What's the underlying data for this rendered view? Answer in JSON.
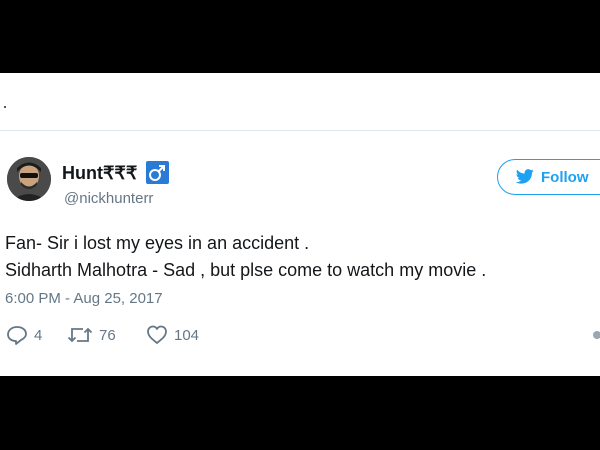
{
  "tweet": {
    "user": {
      "display_name": "Hunt₹₹₹",
      "handle": "@nickhunterr",
      "badge_icon": "male-symbol-icon",
      "badge_color": "#2a7bd6"
    },
    "follow_button": {
      "label": "Follow",
      "icon": "twitter-bird-icon",
      "color": "#1da1f2"
    },
    "text_lines": [
      "Fan- Sir i lost my eyes in an accident .",
      "Sidharth Malhotra - Sad , but plse come to watch my movie ."
    ],
    "timestamp": "6:00 PM - Aug 25, 2017",
    "actions": {
      "replies": {
        "icon": "reply-icon",
        "count": "4"
      },
      "retweets": {
        "icon": "retweet-icon",
        "count": "76"
      },
      "likes": {
        "icon": "heart-icon",
        "count": "104"
      },
      "more": {
        "icon": "more-icon"
      }
    }
  },
  "colors": {
    "background": "#000000",
    "card": "#ffffff",
    "text": "#14171a",
    "secondary": "#657786",
    "accent": "#1da1f2"
  }
}
